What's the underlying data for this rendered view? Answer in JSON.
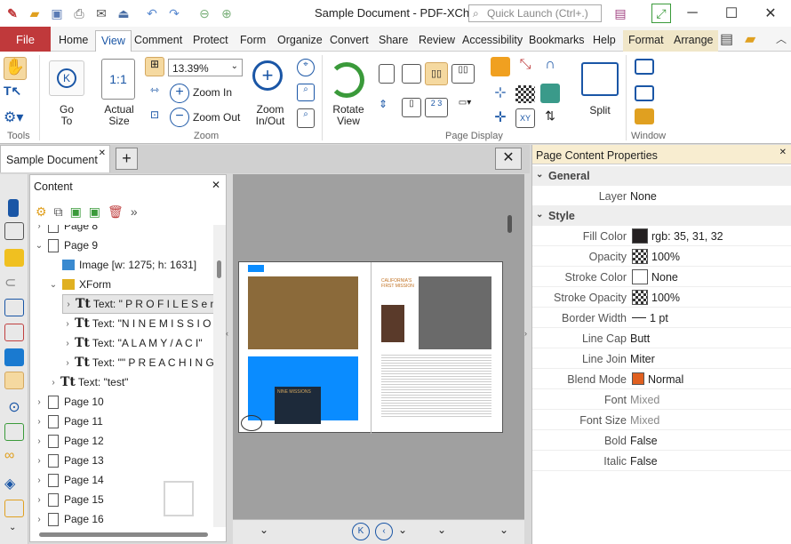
{
  "title": "Sample Document - PDF-XCha...",
  "search_placeholder": "Quick Launch (Ctrl+.)",
  "menu": [
    "File",
    "Home",
    "View",
    "Comment",
    "Protect",
    "Form",
    "Organize",
    "Convert",
    "Share",
    "Review",
    "Accessibility",
    "Bookmarks",
    "Help",
    "Format",
    "Arrange"
  ],
  "ribbon": {
    "groups": {
      "tools": "Tools",
      "zoom": "Zoom",
      "page_display": "Page Display",
      "window": "Window"
    },
    "goto": "Go\nTo",
    "actual_size": "Actual\nSize",
    "zoom_value": "13.39%",
    "zoom_in": "Zoom In",
    "zoom_out": "Zoom Out",
    "zoom_inout": "Zoom\nIn/Out",
    "rotate_view": "Rotate\nView",
    "split": "Split"
  },
  "doc_tab": "Sample Document",
  "content_panel": {
    "title": "Content",
    "rows": [
      {
        "label": "Page 8",
        "indent": 0,
        "type": "page",
        "twisty": "›"
      },
      {
        "label": "Page 9",
        "indent": 0,
        "type": "page",
        "twisty": "⌄"
      },
      {
        "label": "Image [w: 1275; h: 1631]",
        "indent": 1,
        "type": "image",
        "twisty": ""
      },
      {
        "label": "XForm",
        "indent": 1,
        "type": "xform",
        "twisty": "⌄"
      },
      {
        "label": "Text: \" P R O F I L E S e n v",
        "indent": 2,
        "type": "text",
        "twisty": "›",
        "selected": true
      },
      {
        "label": "Text: \"N I N E M I S S I O N",
        "indent": 2,
        "type": "text",
        "twisty": "›"
      },
      {
        "label": "Text: \"A L A M Y / A C I\"",
        "indent": 2,
        "type": "text",
        "twisty": "›"
      },
      {
        "label": "Text: \"\" P R E A C H I N G A",
        "indent": 2,
        "type": "text",
        "twisty": "›"
      },
      {
        "label": "Text: \"test\"",
        "indent": 1,
        "type": "text",
        "twisty": "›"
      },
      {
        "label": "Page 10",
        "indent": 0,
        "type": "page",
        "twisty": "›"
      },
      {
        "label": "Page 11",
        "indent": 0,
        "type": "page",
        "twisty": "›"
      },
      {
        "label": "Page 12",
        "indent": 0,
        "type": "page",
        "twisty": "›"
      },
      {
        "label": "Page 13",
        "indent": 0,
        "type": "page",
        "twisty": "›"
      },
      {
        "label": "Page 14",
        "indent": 0,
        "type": "page",
        "twisty": "›"
      },
      {
        "label": "Page 15",
        "indent": 0,
        "type": "page",
        "twisty": "›"
      },
      {
        "label": "Page 16",
        "indent": 0,
        "type": "page",
        "twisty": "›"
      }
    ]
  },
  "page_content": {
    "right_header": "CALIFORNIA'S FIRST MISSION",
    "left_header": "NINE MISSIONS"
  },
  "properties": {
    "header": "Page Content Properties",
    "sections": {
      "general": "General",
      "style": "Style"
    },
    "layer": {
      "key": "Layer",
      "value": "None"
    },
    "fill_color": {
      "key": "Fill Color",
      "value": "rgb: 35, 31, 32",
      "color": "#231f20"
    },
    "opacity": {
      "key": "Opacity",
      "value": "100%"
    },
    "stroke_color": {
      "key": "Stroke Color",
      "value": "None"
    },
    "stroke_opacity": {
      "key": "Stroke Opacity",
      "value": "100%"
    },
    "border_width": {
      "key": "Border Width",
      "value": "1 pt"
    },
    "line_cap": {
      "key": "Line Cap",
      "value": "Butt"
    },
    "line_join": {
      "key": "Line Join",
      "value": "Miter"
    },
    "blend_mode": {
      "key": "Blend Mode",
      "value": "Normal"
    },
    "font": {
      "key": "Font",
      "value": "Mixed"
    },
    "font_size": {
      "key": "Font Size",
      "value": "Mixed"
    },
    "bold": {
      "key": "Bold",
      "value": "False"
    },
    "italic": {
      "key": "Italic",
      "value": "False"
    }
  },
  "colors": {
    "file_tab": "#c0393b",
    "accent": "#1a56a6",
    "selection_blue": "#0a8cff"
  }
}
